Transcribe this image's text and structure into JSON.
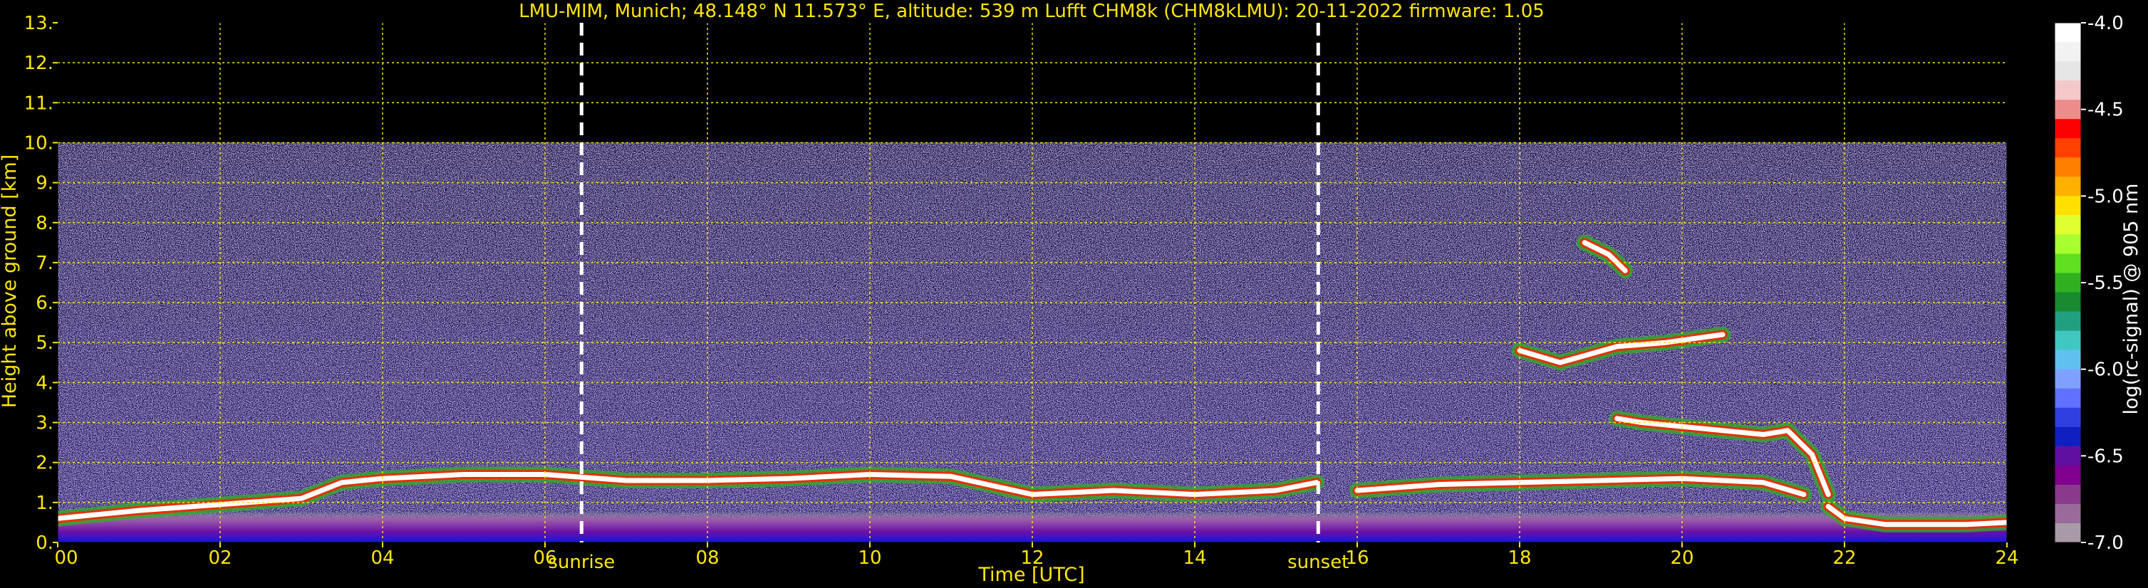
{
  "chart_data": {
    "type": "heatmap",
    "title": "LMU-MIM, Munich; 48.148° N 11.573° E, altitude: 539 m    Lufft CHM8k (CHM8kLMU): 20-11-2022    firmware: 1.05",
    "xlabel": "Time [UTC]",
    "ylabel": "Height above ground [km]",
    "xlim": [
      0,
      24
    ],
    "ylim": [
      0,
      13
    ],
    "x_ticks": [
      "00",
      "02",
      "04",
      "06",
      "08",
      "10",
      "12",
      "14",
      "16",
      "18",
      "20",
      "22",
      "24"
    ],
    "y_ticks": [
      "0.",
      "1.",
      "2.",
      "3.",
      "4.",
      "5.",
      "6.",
      "7.",
      "8.",
      "9.",
      "10.",
      "11.",
      "12.",
      "13."
    ],
    "grid": true,
    "grid_color": "#ffe600",
    "signal_top_km": 10,
    "events": [
      {
        "name": "sunrise",
        "x": 6.45
      },
      {
        "name": "sunset",
        "x": 15.52
      }
    ],
    "colorbar": {
      "label": "log(rc-signal) @ 905 nm",
      "range": [
        -7.0,
        -4.0
      ],
      "ticks": [
        "-4.0",
        "-4.5",
        "-5.0",
        "-5.5",
        "-6.0",
        "-6.5",
        "-7.0"
      ],
      "colors": [
        "#ffffff",
        "#f2f2f2",
        "#e6e6e6",
        "#f4c8c8",
        "#ee8c8c",
        "#ff0000",
        "#ff4000",
        "#ff8000",
        "#ffb000",
        "#ffe000",
        "#e0ff30",
        "#a8ff30",
        "#60e020",
        "#30b020",
        "#1a8a30",
        "#20a080",
        "#40c8c0",
        "#60c0f0",
        "#80a0ff",
        "#6070ff",
        "#3040e0",
        "#1020c0",
        "#6010a0",
        "#800090",
        "#8a3a8a",
        "#9a6a9a",
        "#a89aa8"
      ]
    },
    "layers": [
      {
        "name": "boundary layer aerosol",
        "start_x": 0,
        "end_x": 24,
        "base_km": 0.15,
        "top_km": 0.75
      },
      {
        "name": "residual layer top",
        "x": [
          0,
          1,
          2,
          3,
          3.5,
          4,
          5,
          6,
          7,
          8,
          9,
          10,
          11,
          12,
          13,
          14,
          15,
          15.5
        ],
        "y_km": [
          0.6,
          0.8,
          0.95,
          1.1,
          1.5,
          1.6,
          1.7,
          1.7,
          1.55,
          1.55,
          1.6,
          1.7,
          1.65,
          1.2,
          1.3,
          1.2,
          1.3,
          1.5
        ]
      },
      {
        "name": "evening aerosol layer",
        "x": [
          16,
          17,
          18,
          19,
          20,
          21,
          21.5
        ],
        "y_km": [
          1.3,
          1.45,
          1.5,
          1.55,
          1.6,
          1.5,
          1.2
        ]
      },
      {
        "name": "cloud layer",
        "x": [
          19.2,
          19.5,
          20,
          20.5,
          21,
          21.3,
          21.6,
          21.8
        ],
        "y_km": [
          3.1,
          3.0,
          2.9,
          2.8,
          2.7,
          2.8,
          2.2,
          1.2
        ]
      },
      {
        "name": "mid-level cloud",
        "x": [
          18,
          18.5,
          19.2,
          19.8,
          20.5
        ],
        "y_km": [
          4.8,
          4.5,
          4.9,
          5.0,
          5.2
        ]
      },
      {
        "name": "high cloud",
        "x": [
          18.8,
          19.1,
          19.3
        ],
        "y_km": [
          7.5,
          7.2,
          6.8
        ]
      },
      {
        "name": "night boundary layer",
        "x": [
          21.8,
          22,
          22.5,
          23,
          23.5,
          24
        ],
        "y_km": [
          0.9,
          0.6,
          0.45,
          0.45,
          0.45,
          0.5
        ]
      }
    ]
  }
}
